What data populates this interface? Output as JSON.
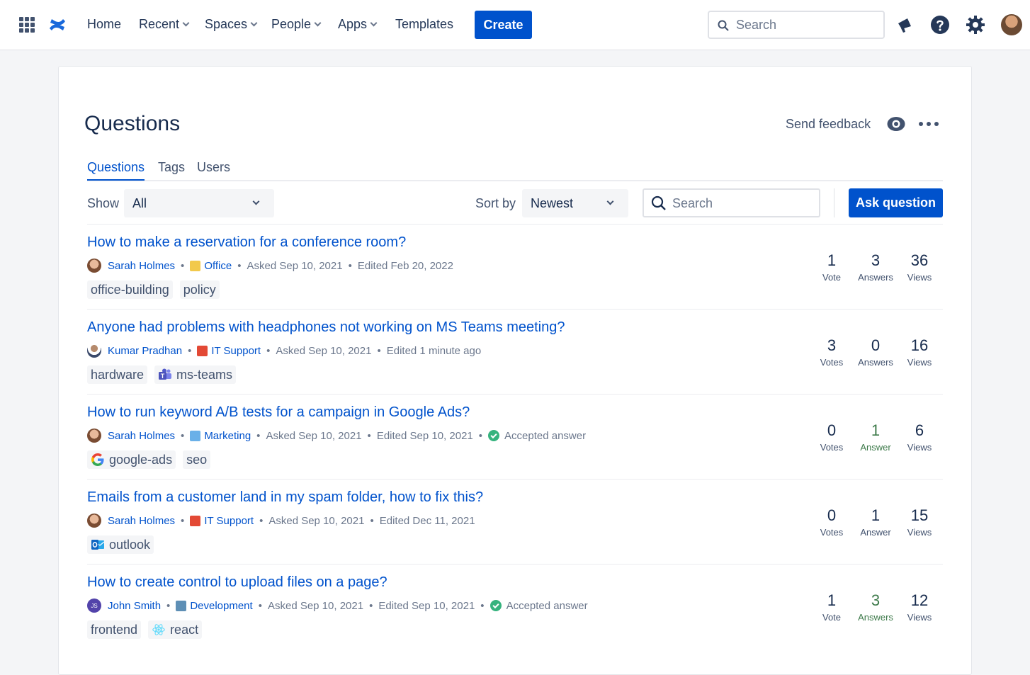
{
  "nav": {
    "home": "Home",
    "recent": "Recent",
    "spaces": "Spaces",
    "people": "People",
    "apps": "Apps",
    "templates": "Templates",
    "create": "Create",
    "search_placeholder": "Search"
  },
  "page": {
    "title": "Questions",
    "send_feedback": "Send feedback"
  },
  "tabs": [
    "Questions",
    "Tags",
    "Users"
  ],
  "filters": {
    "show_label": "Show",
    "show_value": "All",
    "sort_label": "Sort by",
    "sort_value": "Newest",
    "search_placeholder": "Search",
    "ask_button": "Ask question"
  },
  "questions": [
    {
      "title": "How to make a reservation for a conference room?",
      "author": "Sarah Holmes",
      "space": "Office",
      "asked": "Asked Sep 10, 2021",
      "edited": "Edited Feb 20, 2022",
      "accepted": "",
      "tags": [
        "office-building",
        "policy"
      ],
      "votes": "1",
      "votes_label": "Vote",
      "answers": "3",
      "answers_label": "Answers",
      "views": "36",
      "views_label": "Views"
    },
    {
      "title": "Anyone had problems with headphones not working on MS Teams meeting?",
      "author": "Kumar Pradhan",
      "space": "IT Support",
      "asked": "Asked Sep 10, 2021",
      "edited": "Edited 1 minute ago",
      "accepted": "",
      "tags": [
        "hardware",
        "ms-teams"
      ],
      "votes": "3",
      "votes_label": "Votes",
      "answers": "0",
      "answers_label": "Answers",
      "views": "16",
      "views_label": "Views"
    },
    {
      "title": "How to run keyword A/B tests for a campaign in Google Ads?",
      "author": "Sarah Holmes",
      "space": "Marketing",
      "asked": "Asked Sep 10, 2021",
      "edited": "Edited Sep 10, 2021",
      "accepted": "Accepted answer",
      "tags": [
        "google-ads",
        "seo"
      ],
      "votes": "0",
      "votes_label": "Votes",
      "answers": "1",
      "answers_label": "Answer",
      "views": "6",
      "views_label": "Views"
    },
    {
      "title": "Emails from a customer land in my spam folder, how to fix this?",
      "author": "Sarah Holmes",
      "space": "IT Support",
      "asked": "Asked Sep 10, 2021",
      "edited": "Edited Dec 11, 2021",
      "accepted": "",
      "tags": [
        "outlook"
      ],
      "votes": "0",
      "votes_label": "Votes",
      "answers": "1",
      "answers_label": "Answer",
      "views": "15",
      "views_label": "Views"
    },
    {
      "title": "How to create control to upload files on a page?",
      "author": "John Smith",
      "space": "Development",
      "asked": "Asked Sep 10, 2021",
      "edited": "Edited Sep 10, 2021",
      "accepted": "Accepted answer",
      "tags": [
        "frontend",
        "react"
      ],
      "votes": "1",
      "votes_label": "Vote",
      "answers": "3",
      "answers_label": "Answers",
      "views": "12",
      "views_label": "Views"
    }
  ],
  "colors": {
    "accent": "#0052cc",
    "accepted": "#36b37e"
  }
}
